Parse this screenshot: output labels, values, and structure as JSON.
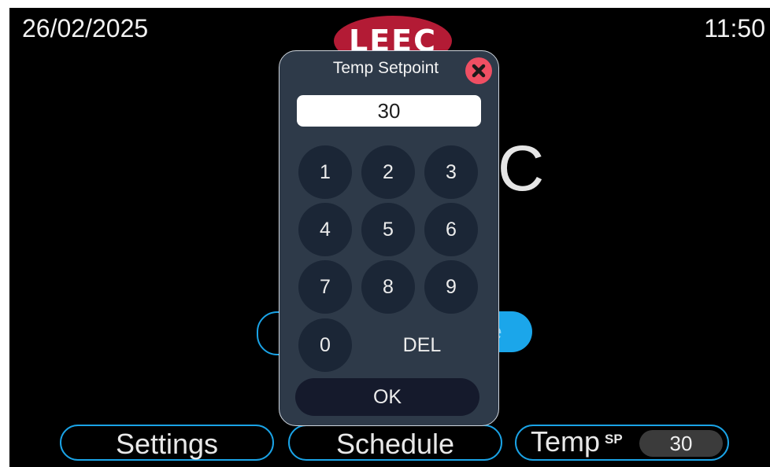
{
  "header": {
    "date": "26/02/2025",
    "time": "11:50",
    "logo": "LEEC"
  },
  "background": {
    "temp_unit_fragment": "C",
    "pill_fragment": "e"
  },
  "bottom_bar": {
    "settings_label": "Settings",
    "schedule_label": "Schedule",
    "temp_label": "Temp",
    "temp_superscript": "SP",
    "temp_value": "30"
  },
  "dialog": {
    "title": "Temp Setpoint",
    "close_icon": "close-icon",
    "input_value": "30",
    "keys": [
      "1",
      "2",
      "3",
      "4",
      "5",
      "6",
      "7",
      "8",
      "9",
      "0"
    ],
    "del_label": "DEL",
    "ok_label": "OK"
  },
  "colors": {
    "accent_blue": "#1aa3e6",
    "logo_red": "#b31b35",
    "dialog_bg": "#2e3a49",
    "key_bg": "#1b2636",
    "close_red": "#ef4f63"
  }
}
